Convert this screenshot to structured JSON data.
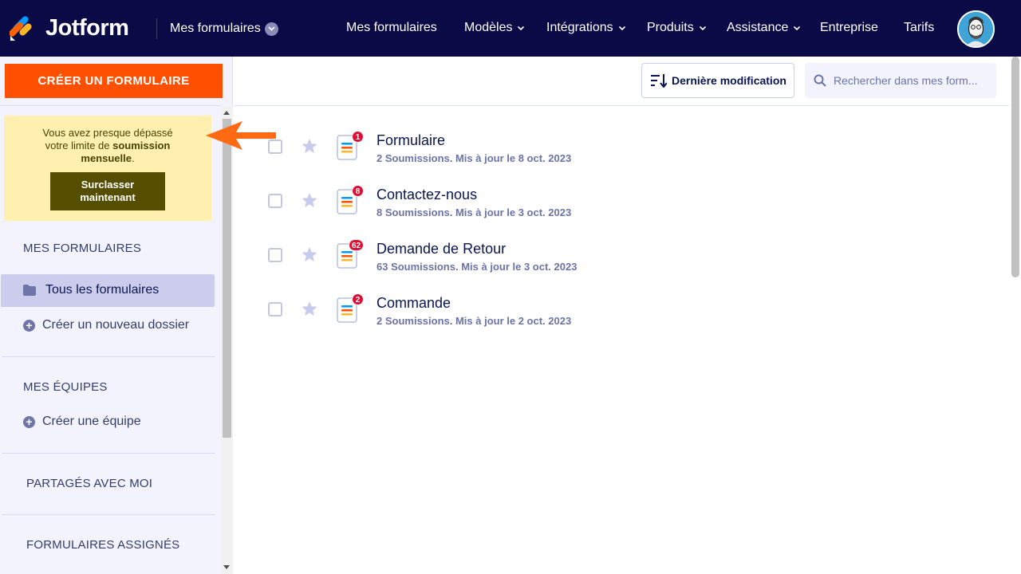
{
  "topbar": {
    "brand": "Jotform",
    "workspace": "Mes formulaires",
    "nav": [
      {
        "label": "Mes formulaires",
        "dropdown": false
      },
      {
        "label": "Modèles",
        "dropdown": true
      },
      {
        "label": "Intégrations",
        "dropdown": true
      },
      {
        "label": "Produits",
        "dropdown": true
      },
      {
        "label": "Assistance",
        "dropdown": true
      },
      {
        "label": "Entreprise",
        "dropdown": false
      },
      {
        "label": "Tarifs",
        "dropdown": false
      }
    ]
  },
  "sidebar": {
    "create_label": "CRÉER UN FORMULAIRE",
    "limit": {
      "line1": "Vous avez presque dépassé",
      "line2_prefix": "votre limite de ",
      "line2_bold": "soumission",
      "line3_bold": "mensuelle",
      "line3_suffix": ".",
      "upgrade_label_1": "Surclasser",
      "upgrade_label_2": "maintenant"
    },
    "my_forms_header": "MES FORMULAIRES",
    "all_forms": "Tous les formulaires",
    "new_folder": "Créer un nouveau dossier",
    "teams_header": "MES ÉQUIPES",
    "new_team": "Créer une équipe",
    "shared_header": "PARTAGÉS AVEC MOI",
    "assigned_header": "FORMULAIRES ASSIGNÉS"
  },
  "toolbar": {
    "sort_label": "Dernière modification",
    "search_placeholder": "Rechercher dans mes form..."
  },
  "forms": [
    {
      "title": "Formulaire",
      "badge": "1",
      "meta": "2 Soumissions. Mis à jour le 8 oct. 2023"
    },
    {
      "title": "Contactez-nous",
      "badge": "8",
      "meta": "8 Soumissions. Mis à jour le 3 oct. 2023"
    },
    {
      "title": "Demande de Retour",
      "badge": "62",
      "meta": "63 Soumissions. Mis à jour le 3 oct. 2023"
    },
    {
      "title": "Commande",
      "badge": "2",
      "meta": "2 Soumissions. Mis à jour le 2 oct. 2023"
    }
  ],
  "colors": {
    "nav_bg": "#0a0a47",
    "create_btn": "#ff4f00",
    "limit_bg": "#fff0b0",
    "upgrade_btn": "#554d00",
    "badge": "#e10e32",
    "annotation_arrow": "#ff6a13"
  },
  "icons": {
    "logo": "jotform-logo-icon",
    "workspace_chevron": "chevron-down-icon",
    "folder": "folder-icon",
    "plus": "plus-circle-icon",
    "sort": "sort-icon",
    "search": "search-icon",
    "star": "star-icon",
    "form": "form-document-icon"
  }
}
